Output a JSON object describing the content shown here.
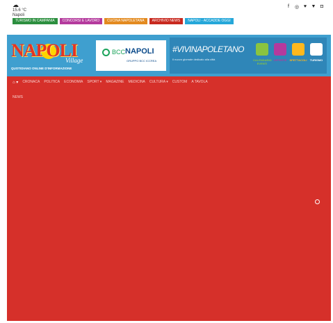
{
  "weather": {
    "temp": "15.6 °C",
    "city": "Napoli"
  },
  "social": [
    "f",
    "◎",
    "♥",
    "▼",
    "◘"
  ],
  "categories": [
    {
      "label": "TURISMO IN CAMPANIA",
      "color": "#2c8f3f"
    },
    {
      "label": "CONCORSI E LAVORO",
      "color": "#b43a9d"
    },
    {
      "label": "CUCINA NAPOLETANA",
      "color": "#e38a1f"
    },
    {
      "label": "ARCHIVIO NEWS",
      "color": "#c8291f"
    },
    {
      "label": "NAPOLI - ACCADDE OGGI",
      "color": "#25a7d9"
    }
  ],
  "banner": {
    "logo_word": "NAPOLI",
    "logo_sub": "Village",
    "logo_tag": "QUOTIDIANO ONLINE D'INFORMAZIONE",
    "bcc_brand": "BCC",
    "bcc_name": "NAPOLI",
    "bcc_sub": "GRUPPO BCC ICCREA",
    "vivi_title": "#VIVINAPOLETANO",
    "vivi_caption": "Il nuovo giornale dedicato alla città",
    "vivi_items": [
      {
        "label": "CALENDARIO EVENTI",
        "color": "#8ac440"
      },
      {
        "label": "OFFERTE",
        "color": "#b43a9d"
      },
      {
        "label": "SPETTACOLI",
        "color": "#ffb81c"
      },
      {
        "label": "TURISMO",
        "color": "#ffffff"
      }
    ]
  },
  "nav": {
    "home": "⌂ ▾",
    "items": [
      "CRONACA",
      "POLITICA",
      "ECONOMIA",
      "SPORT ▾",
      "MAGAZINE",
      "MEDICINA",
      "CULTURA ▾",
      "CUSTOM",
      "A TAVOLA"
    ],
    "row2": "NEWS"
  }
}
